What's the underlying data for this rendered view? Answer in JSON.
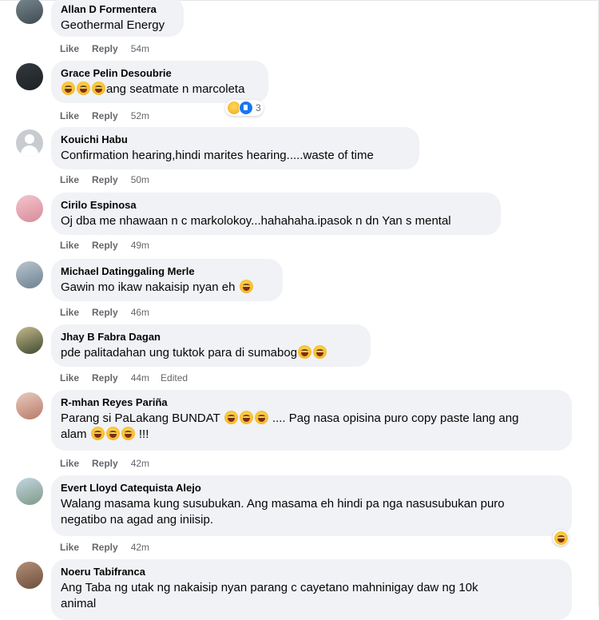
{
  "actions": {
    "like": "Like",
    "reply": "Reply"
  },
  "comments": [
    {
      "author": "Allan D Formentera",
      "lines": [
        "Geothermal Energy"
      ],
      "time": "54m"
    },
    {
      "author": "Grace Pelin Desoubrie",
      "lines": [
        "ang seatmate n marcoleta"
      ],
      "time": "52m",
      "reaction_count": "3"
    },
    {
      "author": "Kouichi Habu",
      "lines": [
        "Confirmation hearing,hindi marites hearing.....waste of time"
      ],
      "time": "50m"
    },
    {
      "author": "Cirilo Espinosa",
      "lines": [
        "Oj dba me nhawaan n c markolokoy...hahahaha.ipasok n dn Yan s mental"
      ],
      "time": "49m"
    },
    {
      "author": "Michael Datinggaling Merle",
      "lines": [
        "Gawin mo ikaw nakaisip nyan eh"
      ],
      "time": "46m"
    },
    {
      "author": "Jhay B Fabra Dagan",
      "lines": [
        "pde palitadahan ung tuktok para di sumabog"
      ],
      "time": "44m",
      "edited": "Edited"
    },
    {
      "author": "R-mhan Reyes Pariña",
      "lines": [
        "Parang si PaLakang BUNDAT",
        ".... Pag nasa opisina puro copy paste lang ang",
        "alam",
        "!!!"
      ],
      "time": "42m"
    },
    {
      "author": "Evert Lloyd Catequista Alejo",
      "lines": [
        "Walang masama kung susubukan. Ang masama eh hindi pa nga nasusubukan puro",
        "negatibo na agad ang iniisip."
      ],
      "time": "42m"
    },
    {
      "author": "Noeru Tabifranca",
      "lines": [
        "Ang Taba ng utak ng nakaisip nyan parang c cayetano mahninigay daw ng 10k",
        "animal"
      ]
    }
  ],
  "icons": {
    "emoji": "laughing-face-icon",
    "avatar_placeholder": "default-user-icon",
    "reaction_like": "like-reaction-icon",
    "reaction_haha": "haha-reaction-icon"
  },
  "colors": {
    "bubble": "#f0f2f5",
    "meta": "#65676b",
    "like_blue": "#1877f2"
  }
}
